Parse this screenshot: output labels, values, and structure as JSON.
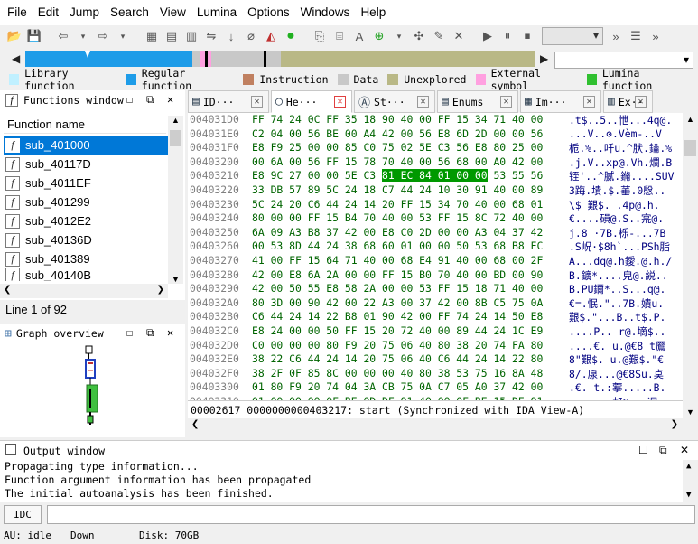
{
  "menu": [
    "File",
    "Edit",
    "Jump",
    "Search",
    "View",
    "Lumina",
    "Options",
    "Windows",
    "Help"
  ],
  "legend": [
    {
      "label": "Library function",
      "color": "#c0f0ff"
    },
    {
      "label": "Regular function",
      "color": "#1e9ce8"
    },
    {
      "label": "Instruction",
      "color": "#c08060"
    },
    {
      "label": "Data",
      "color": "#c8c8c8"
    },
    {
      "label": "Unexplored",
      "color": "#b9b886"
    },
    {
      "label": "External symbol",
      "color": "#ffa0e0"
    },
    {
      "label": "Lumina function",
      "color": "#30c030"
    }
  ],
  "functions_window": {
    "title": "Functions window",
    "column_header": "Function name",
    "items": [
      "sub_401000",
      "sub_40117D",
      "sub_4011EF",
      "sub_401299",
      "sub_4012E2",
      "sub_40136D",
      "sub_401389",
      "sub_40140B"
    ],
    "selected_index": 0,
    "line_count": "Line 1 of 92"
  },
  "graph_overview": {
    "title": "Graph overview"
  },
  "tabs": [
    {
      "label": "ID···",
      "icon": "ida-view-icon",
      "active": false
    },
    {
      "label": "He···",
      "icon": "hex-view-icon",
      "active": true
    },
    {
      "label": "St···",
      "icon": "structures-icon",
      "active": false
    },
    {
      "label": "Enums",
      "icon": "enums-icon",
      "active": false
    },
    {
      "label": "Im···",
      "icon": "imports-icon",
      "active": false
    },
    {
      "label": "Ex···",
      "icon": "exports-icon",
      "active": false
    }
  ],
  "hex_rows": [
    {
      "addr": "004031D0",
      "bytes": "FF 74 24 0C FF 35 18 90  40 00 FF 15 34 71 40 00",
      "ascii": ".t$..5..怈...4q@."
    },
    {
      "addr": "004031E0",
      "bytes": "C2 04 00 56 BE 00 A4 42  00 56 E8 6D 2D 00 00 56",
      "ascii": "...V..ʘ.Vèm-..V"
    },
    {
      "addr": "004031F0",
      "bytes": "E8 F9 25 00 00 85 C0 75  02 5E C3 56 E8 80 25 00",
      "ascii": "栀.%..吀u.^肰.鑰.%"
    },
    {
      "addr": "00403200",
      "bytes": "00 6A 00 56 FF 15 78 70  40 00 56 68 00 A0 42 00",
      "ascii": ".j.V..xp@.Vh.爛.B"
    },
    {
      "addr": "00403210",
      "bytes": "E8 9C 27 00 00 5E C3 81  EC 84 01 00 00 53 55 56",
      "ascii": "铚'..^膩.鏅....SUV"
    },
    {
      "addr": "00403220",
      "bytes": "33 DB 57 89 5C 24 18 C7  44 24 10 30 91 40 00 89",
      "ascii": "3踇.墤.$.菙.0慇.."
    },
    {
      "addr": "00403230",
      "bytes": "5C 24 20 C6 44 24 14 20  FF 15 34 70 40 00 68 01",
      "ascii": "\\$ 艱$.  .4p@.h."
    },
    {
      "addr": "00403240",
      "bytes": "80 00 00 FF 15 B4 70 40  00 53 FF 15 8C 72 40 00",
      "ascii": "€....磒@.S..宺@."
    },
    {
      "addr": "00403250",
      "bytes": "6A 09 A3 B8 37 42 00 E8  C0 2D 00 00 A3 04 37 42",
      "ascii": "j.8 ·7B.栎-...7B"
    },
    {
      "addr": "00403260",
      "bytes": "00 53 8D 44 24 38 68 60  01 00 00 50 53 68 B8 EC",
      "ascii": ".S岲·$8h`...PSh脂"
    },
    {
      "addr": "00403270",
      "bytes": "41 00 FF 15 64 71 40 00  68 E4 91 40 00 68 00 2F",
      "ascii": "A...dq@.h鑀.@.h./"
    },
    {
      "addr": "00403280",
      "bytes": "42 00 E8 6A 2A 00 00 FF  15 B0 70 40 00 BD 00 90",
      "ascii": "B.鑛*....皃@.綐.."
    },
    {
      "addr": "00403290",
      "bytes": "42 00 50 55 E8 58 2A 00  00 53 FF 15 18 71 40 00",
      "ascii": "B.PU鑈*..S...q@."
    },
    {
      "addr": "004032A0",
      "bytes": "80 3D 00 90 42 00 22 A3  00 37 42 00 8B C5 75 0A",
      "ascii": "€=.怋.\"..7B.嬇u."
    },
    {
      "addr": "004032B0",
      "bytes": "C6 44 24 14 22 B8 01 90  42 00 FF 74 24 14 50 E8",
      "ascii": "艱$.\"...B..t$.P."
    },
    {
      "addr": "004032C0",
      "bytes": "E8 24 00 00 50 FF 15 20  72 40 00 89 44 24 1C E9",
      "ascii": "....P.. r@.墑$.."
    },
    {
      "addr": "004032D0",
      "bytes": "C0 00 00 00 80 F9 20 75  06 40 80 38 20 74 FA 80",
      "ascii": "....€. u.@€8 t鷢"
    },
    {
      "addr": "004032E0",
      "bytes": "38 22 C6 44 24 14 20 75  06 40 C6 44 24 14 22 80",
      "ascii": "8\"艱$. u.@艱$.\"€"
    },
    {
      "addr": "004032F0",
      "bytes": "38 2F 0F 85 8C 00 00 00  40 80 38 53 75 16 8A 48",
      "ascii": "8/.厡...@€8Su.奌"
    },
    {
      "addr": "00403300",
      "bytes": "01 80 F9 20 74 04 3A CB  75 0A C7 05 A0 37 42 00",
      "ascii": ".€. t.:藆.....B."
    },
    {
      "addr": "00403310",
      "bytes": "01 00 00 00 0F BE 0D DF  91 40 00 0F BE 15 DE 91",
      "ascii": ".......邞@...迵"
    }
  ],
  "hex_highlight": {
    "row": 4,
    "text": "81  EC 84 01 00 00"
  },
  "hex_status": "00002617 0000000000403217: start (Synchronized with IDA View-A)",
  "output": {
    "title": "Output window",
    "lines": [
      "Propagating type information...",
      "Function argument information has been propagated",
      "The initial autoanalysis has been finished."
    ]
  },
  "idc_button": "IDC",
  "status": {
    "au": "AU:  idle",
    "direction": "Down",
    "disk": "Disk: 70GB"
  }
}
